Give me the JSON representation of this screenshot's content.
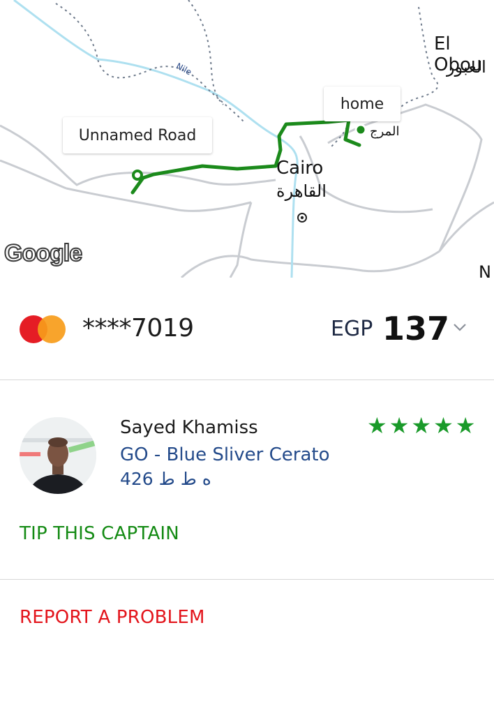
{
  "map": {
    "labels": {
      "el_obour_en": "El Obou",
      "el_obour_ar": "العبور",
      "cairo_en": "Cairo",
      "cairo_ar": "القاهرة",
      "nile": "Nile",
      "marg_ar": "المرج",
      "edge_n": "N"
    },
    "callouts": {
      "pickup": "Unnamed Road",
      "dropoff": "home"
    },
    "attribution": "Google",
    "route_color": "#1b8a1b"
  },
  "payment": {
    "card_brand": "mastercard",
    "card_number": "****7019",
    "currency": "EGP",
    "amount": "137",
    "expand_icon": "chevron-down-icon"
  },
  "captain": {
    "name": "Sayed Khamiss",
    "car": "GO - Blue Sliver Cerato",
    "plate": "426 ه ط ط",
    "rating_stars": 5,
    "star_color": "#1a9a2a"
  },
  "actions": {
    "tip_label": "TIP THIS CAPTAIN",
    "tip_color": "#138a13",
    "report_label": "REPORT A PROBLEM",
    "report_color": "#e3141b"
  }
}
